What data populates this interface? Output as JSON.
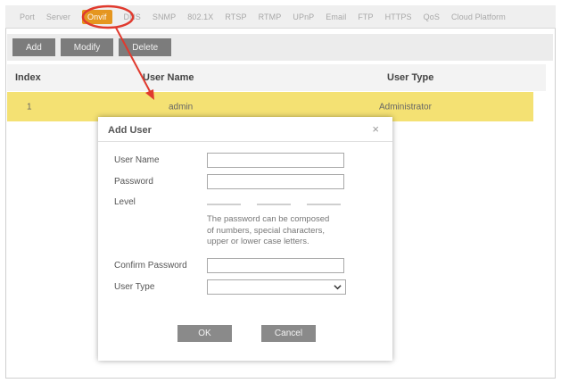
{
  "tabs": [
    {
      "label": "Port",
      "active": false
    },
    {
      "label": "Server",
      "active": false
    },
    {
      "label": "Onvif",
      "active": true
    },
    {
      "label": "DNS",
      "active": false
    },
    {
      "label": "SNMP",
      "active": false
    },
    {
      "label": "802.1X",
      "active": false
    },
    {
      "label": "RTSP",
      "active": false
    },
    {
      "label": "RTMP",
      "active": false
    },
    {
      "label": "UPnP",
      "active": false
    },
    {
      "label": "Email",
      "active": false
    },
    {
      "label": "FTP",
      "active": false
    },
    {
      "label": "HTTPS",
      "active": false
    },
    {
      "label": "QoS",
      "active": false
    },
    {
      "label": "Cloud Platform",
      "active": false
    }
  ],
  "toolbar": {
    "add_label": "Add",
    "modify_label": "Modify",
    "delete_label": "Delete"
  },
  "table": {
    "headers": {
      "index": "Index",
      "user_name": "User Name",
      "user_type": "User Type"
    },
    "rows": [
      {
        "index": "1",
        "user_name": "admin",
        "user_type": "Administrator"
      }
    ]
  },
  "dialog": {
    "title": "Add User",
    "close_glyph": "×",
    "user_name_label": "User Name",
    "user_name_value": "",
    "password_label": "Password",
    "password_value": "",
    "level_label": "Level",
    "hint_line1": "The password can be composed",
    "hint_line2": "of numbers, special characters,",
    "hint_line3": "upper or lower case letters.",
    "confirm_label": "Confirm Password",
    "confirm_value": "",
    "user_type_label": "User Type",
    "user_type_value": "",
    "ok_label": "OK",
    "cancel_label": "Cancel"
  },
  "colors": {
    "active_tab": "#e5961f",
    "row_highlight": "#f4e173",
    "annotation": "#e03a2e"
  },
  "icons": {
    "close": "close-icon",
    "dropdown": "chevron-down-icon"
  }
}
